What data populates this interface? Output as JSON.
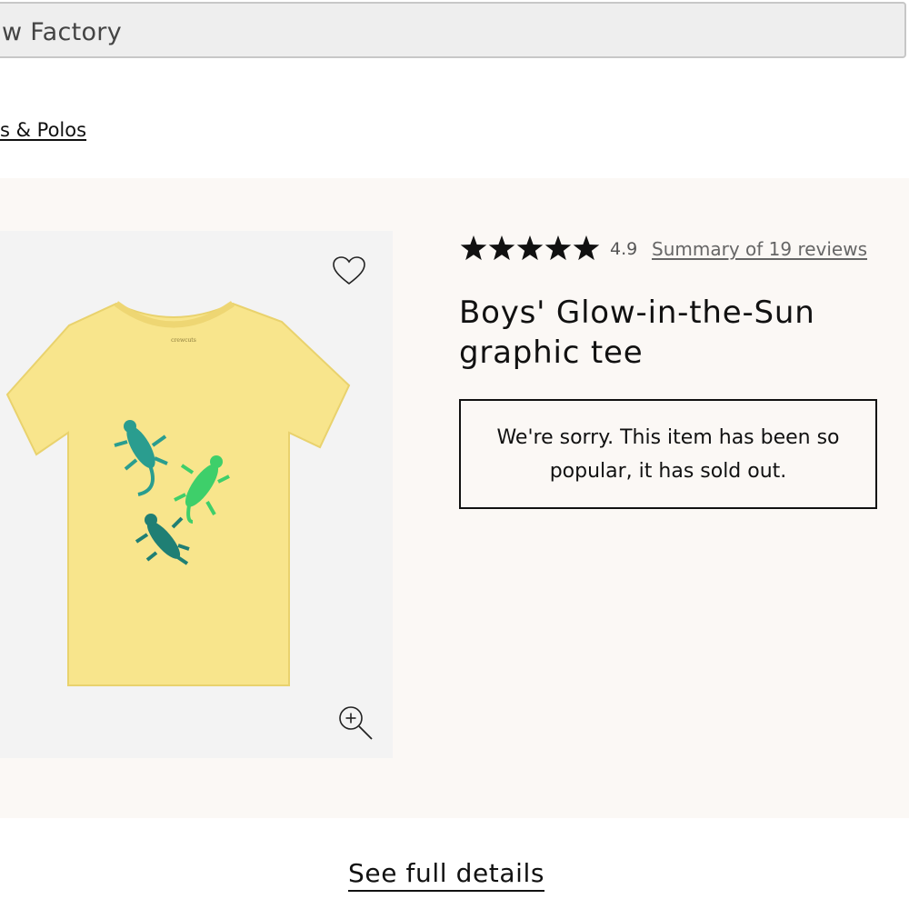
{
  "browser": {
    "title": "w Factory"
  },
  "breadcrumb": {
    "label": "s & Polos"
  },
  "product": {
    "rating_value": "4.9",
    "rating_stars": 5,
    "reviews_link": "Summary of 19 reviews",
    "title": "Boys' Glow-in-the-Sun graphic tee",
    "sold_out_message": "We're sorry. This item has been so popular, it has sold out.",
    "image": {
      "shirt_color": "#f8e58c",
      "graphic_colors": [
        "#2a9d8f",
        "#3ecf6a",
        "#1f7f74"
      ]
    }
  },
  "icons": {
    "wishlist": "heart-icon",
    "zoom": "zoom-in-icon",
    "star": "star-icon"
  },
  "details_link": {
    "label": "See full details"
  }
}
